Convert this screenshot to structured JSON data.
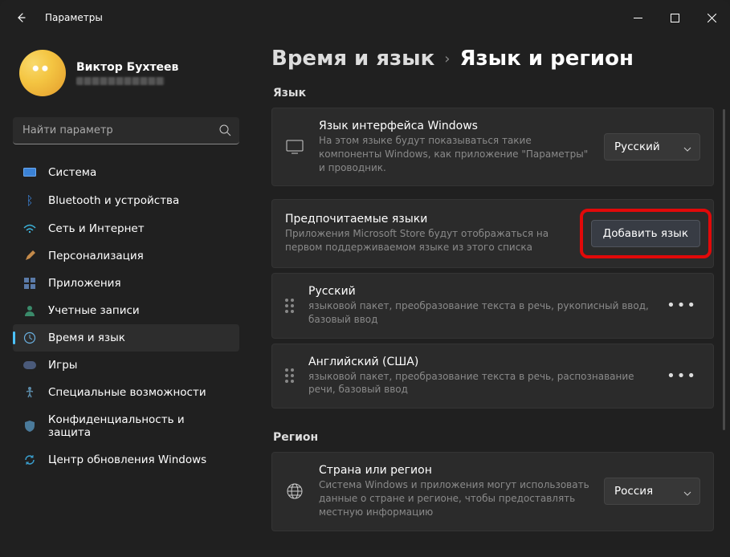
{
  "app_title": "Параметры",
  "profile": {
    "name": "Виктор Бухтеев"
  },
  "search": {
    "placeholder": "Найти параметр"
  },
  "sidebar": {
    "items": [
      {
        "label": "Система"
      },
      {
        "label": "Bluetooth и устройства"
      },
      {
        "label": "Сеть и Интернет"
      },
      {
        "label": "Персонализация"
      },
      {
        "label": "Приложения"
      },
      {
        "label": "Учетные записи"
      },
      {
        "label": "Время и язык"
      },
      {
        "label": "Игры"
      },
      {
        "label": "Специальные возможности"
      },
      {
        "label": "Конфиденциальность и защита"
      },
      {
        "label": "Центр обновления Windows"
      }
    ]
  },
  "breadcrumb": {
    "parent": "Время и язык",
    "current": "Язык и регион"
  },
  "sections": {
    "language_label": "Язык",
    "region_label": "Регион"
  },
  "display_lang": {
    "title": "Язык интерфейса Windows",
    "desc": "На этом языке будут показываться такие компоненты Windows, как приложение \"Параметры\" и проводник.",
    "value": "Русский"
  },
  "preferred": {
    "title": "Предпочитаемые языки",
    "desc": "Приложения Microsoft Store будут отображаться на первом поддерживаемом языке из этого списка",
    "add_button": "Добавить язык"
  },
  "langs": [
    {
      "name": "Русский",
      "desc": "языковой пакет, преобразование текста в речь, рукописный ввод, базовый ввод"
    },
    {
      "name": "Английский (США)",
      "desc": "языковой пакет, преобразование текста в речь, распознавание речи, базовый ввод"
    }
  ],
  "region": {
    "title": "Страна или регион",
    "desc": "Система Windows и приложения могут использовать данные о стране и регионе, чтобы предоставлять местную информацию",
    "value": "Россия"
  }
}
